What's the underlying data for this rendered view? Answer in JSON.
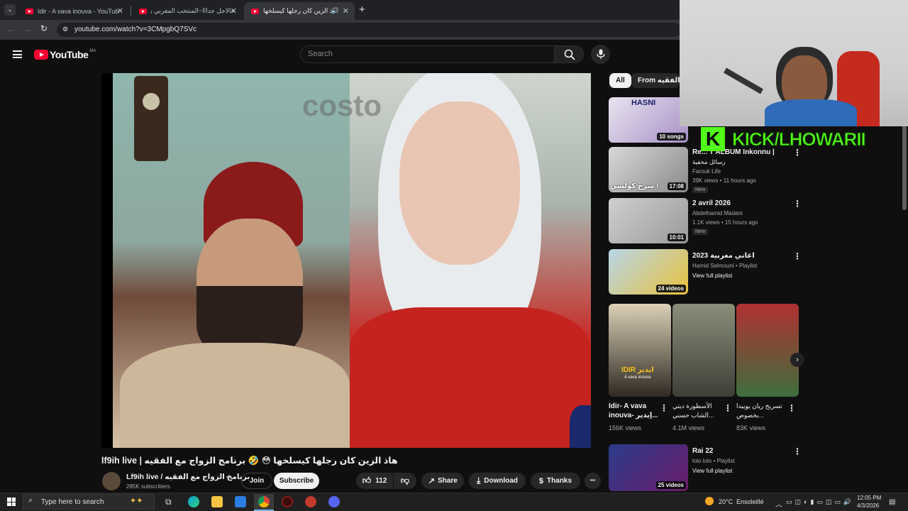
{
  "browser": {
    "tabs": [
      {
        "title": "Idir - A vava inouva - YouTube",
        "active": false
      },
      {
        "title": "عالاجل جدااا~المنتخب المغربي و",
        "active": false
      },
      {
        "title": "هاذ الزين كان رجلها كيسلخها",
        "active": true
      }
    ],
    "new_tab": "+",
    "url": "youtube.com/watch?v=3CMpgbQ7SVc"
  },
  "header": {
    "logo": "YouTube",
    "region": "MA",
    "search_placeholder": "Search"
  },
  "video": {
    "watermark": "costo",
    "title": "lf9ih live | هاذ الزين كان رجلها كيسلخها 😳 🤣 برنامج الزواج مع الفقيه",
    "channel": "Lf9ih live / برنامج الزواج مع الفقيه",
    "subscribers": "285K subscribers",
    "join": "Join",
    "subscribe": "Subscribe",
    "likes": "112",
    "share": "Share",
    "download": "Download",
    "thanks": "Thanks",
    "more": "•••"
  },
  "chips": [
    {
      "label": "All",
      "active": true
    },
    {
      "label": "From برنامج الزواج مع الفقيه",
      "active": false
    }
  ],
  "sidebar": {
    "items": [
      {
        "duration": "10 songs",
        "thumb_text": "HASNI"
      },
      {
        "title": "Re... T ALBUM Inkonnu |",
        "title2": "رسائل مخفية",
        "channel": "Farouk Life",
        "meta": "39K views • 11 hours ago",
        "badge": "New",
        "duration": "17:08",
        "thumb_text": "شرح كولشي !"
      },
      {
        "title": "2 avril 2026",
        "channel": "Abdelhamid Madani",
        "meta": "1.1K views • 15 hours ago",
        "badge": "New",
        "duration": "10:01"
      },
      {
        "title": "اغاني مغربية 2023",
        "channel": "Hamid Selmouni • Playlist",
        "meta": "View full playlist",
        "duration": "24 videos"
      },
      {
        "title": "Rai 22",
        "channel": "lolo lolo • Playlist",
        "meta": "View full playlist",
        "duration": "25 videos"
      }
    ],
    "shorts": [
      {
        "title": "Idir- A vava inouva- إيدير...",
        "views": "156K views",
        "thumb_text": "IDIR ايدير",
        "thumb_sub": "A vava inouva"
      },
      {
        "title": "الأسطورة ديتي الشاب حسني...",
        "views": "4.1M views"
      },
      {
        "title": "تسريح ريان يويبدا بخصوص...",
        "views": "83K views"
      }
    ]
  },
  "overlay": {
    "kick": "KICK/LHOWARII",
    "kick_letter": "K"
  },
  "taskbar": {
    "search_placeholder": "Type here to search",
    "weather": "20°C  Ensoleillé",
    "time": "12:05 PM",
    "date": "4/3/2026"
  },
  "colors": {
    "brand": "#ff0033",
    "kick": "#53fc18",
    "bg": "#0f0f0f"
  }
}
